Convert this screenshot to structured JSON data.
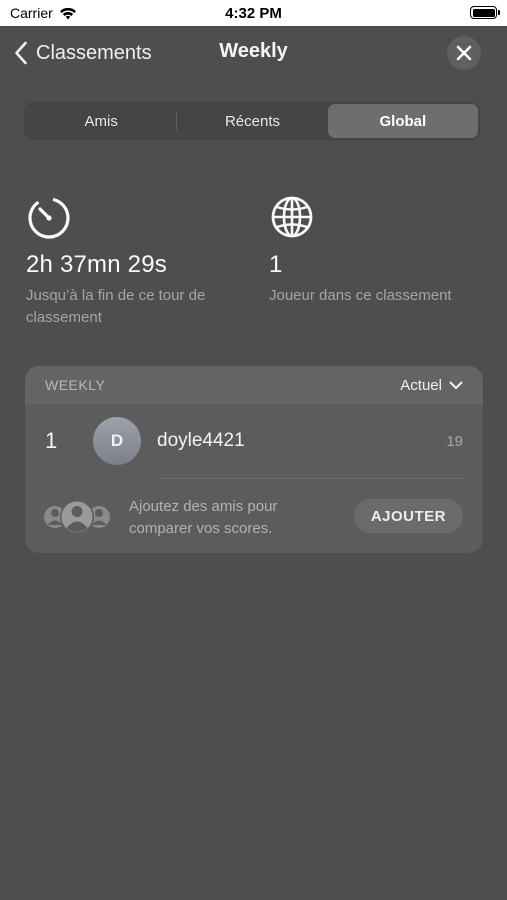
{
  "status_bar": {
    "carrier": "Carrier",
    "time": "4:32 PM"
  },
  "header": {
    "back_label": "Classements",
    "title": "Weekly"
  },
  "tabs": [
    {
      "label": "Amis",
      "active": false
    },
    {
      "label": "Récents",
      "active": false
    },
    {
      "label": "Global",
      "active": true
    }
  ],
  "stats": {
    "timer": {
      "icon": "timer-icon",
      "value": "2h 37mn 29s",
      "caption": "Jusqu’à la fin de ce tour de classement"
    },
    "players": {
      "icon": "globe-icon",
      "value": "1",
      "caption": "Joueur dans ce classement"
    }
  },
  "leaderboard": {
    "header_label": "WEEKLY",
    "period": "Actuel",
    "entries": [
      {
        "rank": "1",
        "initial": "D",
        "username": "doyle4421",
        "score": "19"
      }
    ],
    "invite": {
      "text": "Ajoutez des amis pour comparer vos scores.",
      "button_label": "AJOUTER"
    }
  },
  "colors": {
    "background": "#4e4e4e",
    "card": "#5c5c5c",
    "segment_active": "#6e6e6e"
  }
}
